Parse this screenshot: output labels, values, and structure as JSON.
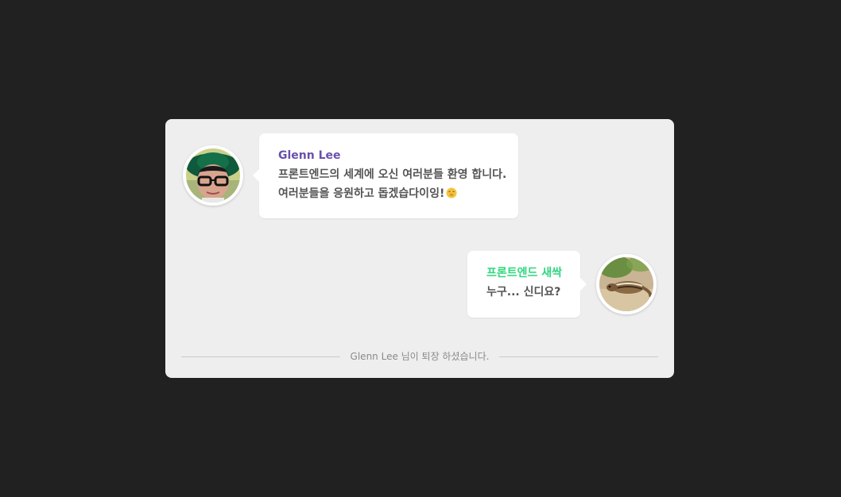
{
  "messages": [
    {
      "sender": "Glenn Lee",
      "sender_color": "#6a4fae",
      "lines": [
        "프론트엔드의 세계에 오신 여러분들 환영 합니다.",
        "여러분들을 응원하고 돕겠습다이잉!"
      ],
      "emoji": "hush-face-emoji",
      "avatar": "glenn-lee-avatar",
      "side": "left"
    },
    {
      "sender": "프론트엔드 새싹",
      "sender_color": "#2fd77f",
      "lines": [
        "누구... 신디요?"
      ],
      "avatar": "chipmunk-avatar",
      "side": "right"
    }
  ],
  "system_notice": "Glenn Lee 님이 퇴장 하셨습니다.",
  "colors": {
    "background": "#212121",
    "card": "#eeeeee",
    "bubble": "#ffffff",
    "text": "#545454",
    "notice": "#8a8a8a"
  }
}
